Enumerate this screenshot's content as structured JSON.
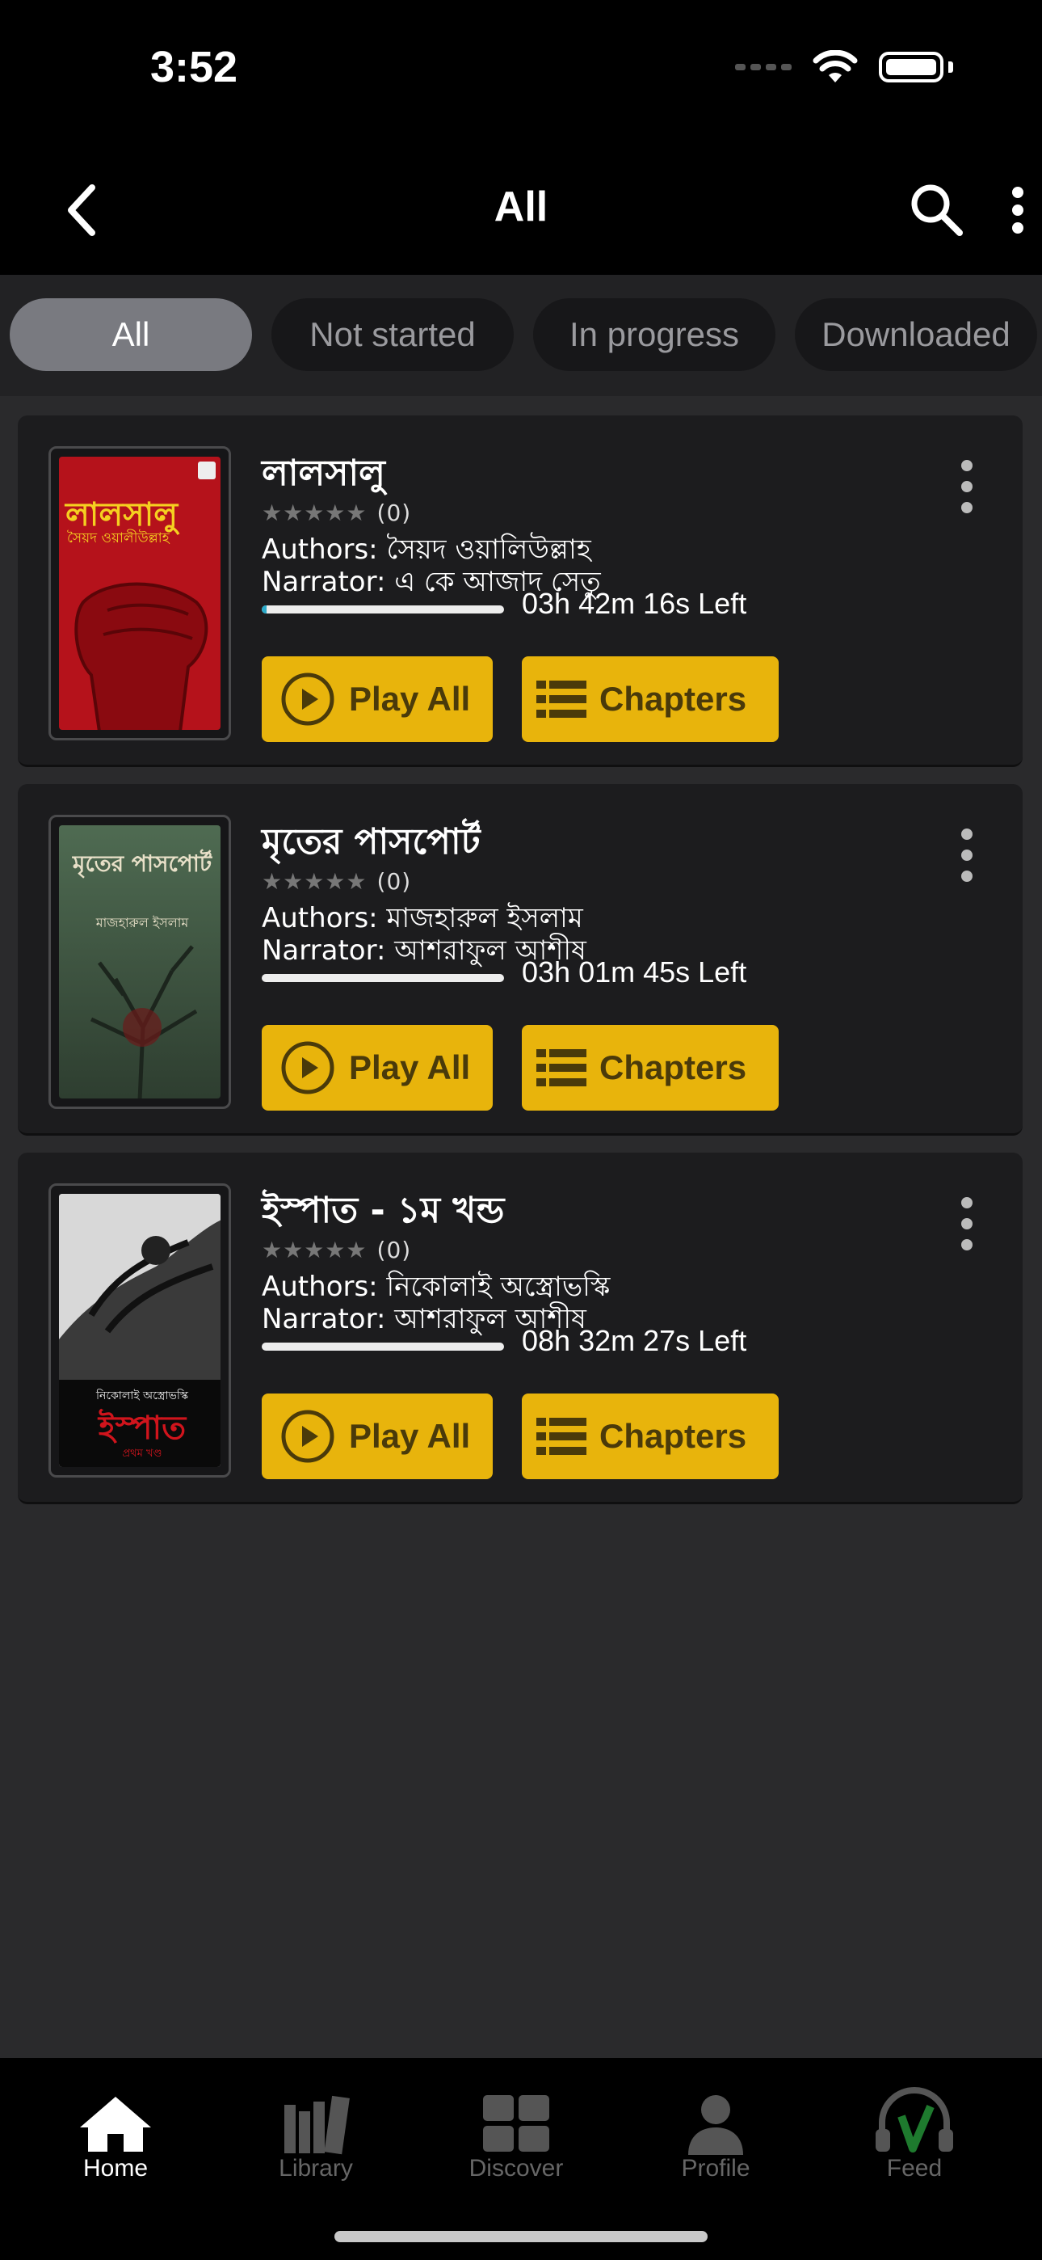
{
  "status_bar": {
    "time": "3:52"
  },
  "nav": {
    "title": "All"
  },
  "filters": [
    {
      "label": "All",
      "active": true
    },
    {
      "label": "Not started",
      "active": false
    },
    {
      "label": "In progress",
      "active": false
    },
    {
      "label": "Downloaded",
      "active": false
    }
  ],
  "books": [
    {
      "title": "লালসালু",
      "rating_count": "(0)",
      "authors": "Authors: সৈয়দ ওয়ালিউল্লাহ",
      "narrator": "Narrator: এ কে আজাদ সেতু",
      "time_left": "03h 42m 16s  Left",
      "progress": 0.02,
      "play_label": "Play All",
      "chapters_label": "Chapters",
      "cover_title": "লালসালু",
      "cover_author": "সৈয়দ ওয়ালীউল্লাহ"
    },
    {
      "title": "মৃতের পাসপোর্ট",
      "rating_count": "(0)",
      "authors": "Authors: মাজহারুল ইসলাম",
      "narrator": "Narrator: আশরাফুল আশীষ",
      "time_left": "03h 01m 45s  Left",
      "progress": 0,
      "play_label": "Play All",
      "chapters_label": "Chapters",
      "cover_title": "মৃতের পাসপোর্ট",
      "cover_author": "মাজহারুল ইসলাম"
    },
    {
      "title": "ইস্পাত - ১ম খন্ড",
      "rating_count": "(0)",
      "authors": "Authors: নিকোলাই অস্ত্রোভস্কি",
      "narrator": "Narrator: আশরাফুল আশীষ",
      "time_left": "08h 32m 27s  Left",
      "progress": 0,
      "play_label": "Play All",
      "chapters_label": "Chapters",
      "cover_title": "ইস্পাত",
      "cover_author": "নিকোলাই অস্ত্রোভস্কি",
      "cover_subtitle": "প্রথম খণ্ড"
    }
  ],
  "tabbar": [
    {
      "label": "Home",
      "icon": "home-icon",
      "active": true
    },
    {
      "label": "Library",
      "icon": "library-icon",
      "active": false
    },
    {
      "label": "Discover",
      "icon": "discover-icon",
      "active": false
    },
    {
      "label": "Profile",
      "icon": "profile-icon",
      "active": false
    },
    {
      "label": "Feed",
      "icon": "feed-icon",
      "active": false
    }
  ],
  "colors": {
    "accent": "#e8b40c",
    "progress": "#2aa9c9",
    "background": "#2a2a2c"
  }
}
